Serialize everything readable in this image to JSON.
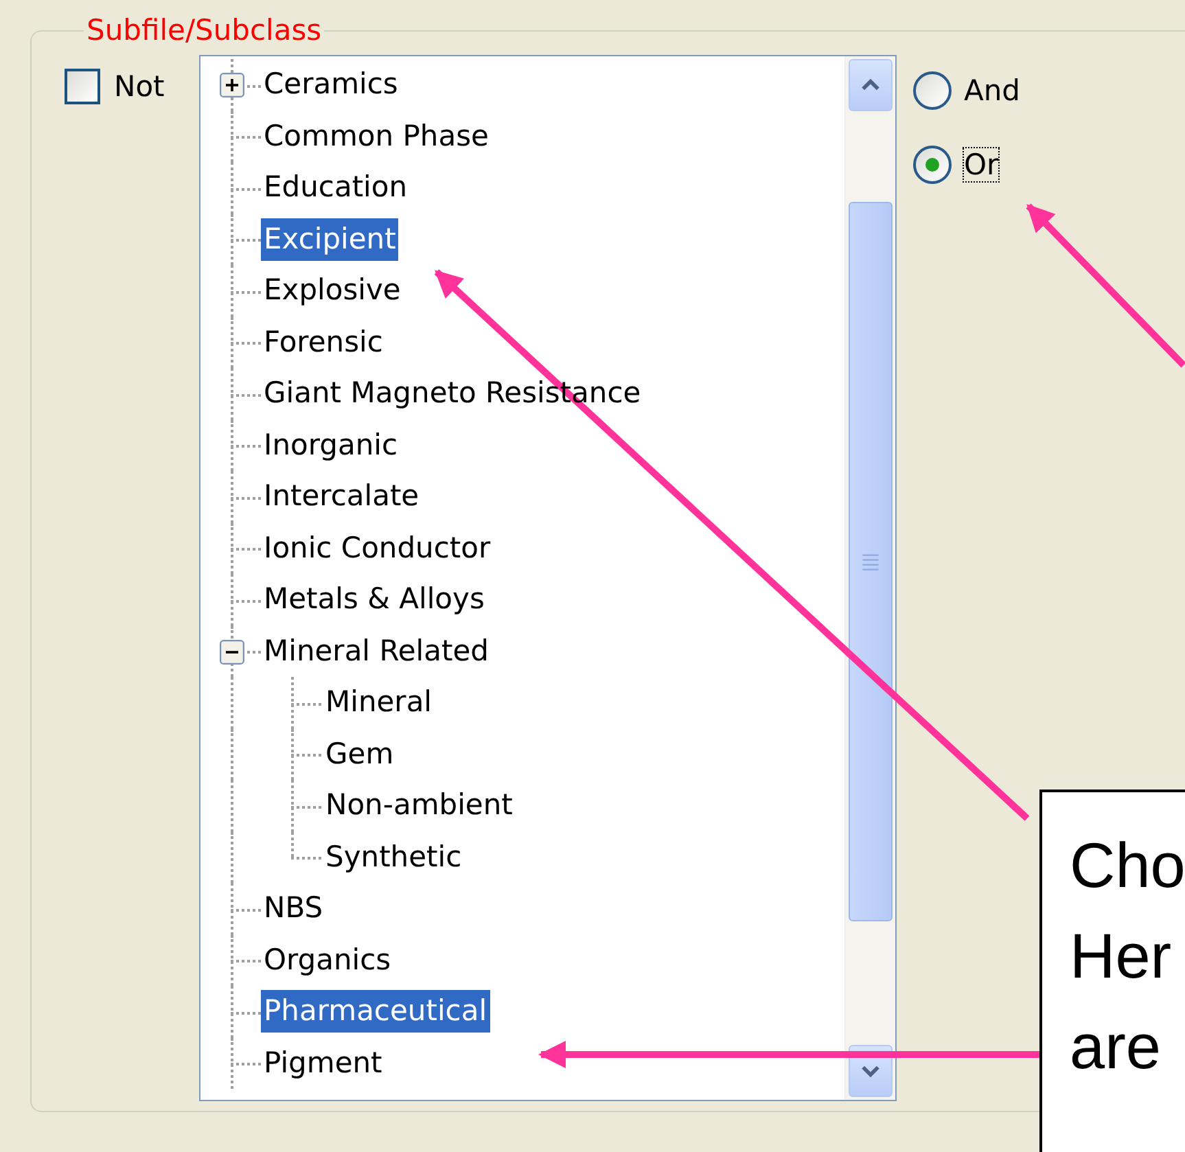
{
  "group": {
    "title": "Subfile/Subclass"
  },
  "not_checkbox": {
    "label": "Not",
    "checked": false
  },
  "tree": [
    {
      "label": "Ceramics",
      "selected": false,
      "expanded": false
    },
    {
      "label": "Common Phase",
      "selected": false
    },
    {
      "label": "Education",
      "selected": false
    },
    {
      "label": "Excipient",
      "selected": true
    },
    {
      "label": "Explosive",
      "selected": false
    },
    {
      "label": "Forensic",
      "selected": false
    },
    {
      "label": "Giant Magneto Resistance",
      "selected": false
    },
    {
      "label": "Inorganic",
      "selected": false
    },
    {
      "label": "Intercalate",
      "selected": false
    },
    {
      "label": "Ionic Conductor",
      "selected": false
    },
    {
      "label": "Metals & Alloys",
      "selected": false
    },
    {
      "label": "Mineral Related",
      "selected": false,
      "expanded": true,
      "children": [
        {
          "label": "Mineral",
          "selected": false
        },
        {
          "label": "Gem",
          "selected": false
        },
        {
          "label": "Non-ambient",
          "selected": false
        },
        {
          "label": "Synthetic",
          "selected": false
        }
      ]
    },
    {
      "label": "NBS",
      "selected": false
    },
    {
      "label": "Organics",
      "selected": false
    },
    {
      "label": "Pharmaceutical",
      "selected": true
    },
    {
      "label": "Pigment",
      "selected": false
    }
  ],
  "logic": [
    {
      "label": "And",
      "selected": false,
      "focused": false
    },
    {
      "label": "Or",
      "selected": true,
      "focused": true
    }
  ],
  "callout": {
    "lines": [
      "Cho",
      "Her",
      "are"
    ]
  }
}
